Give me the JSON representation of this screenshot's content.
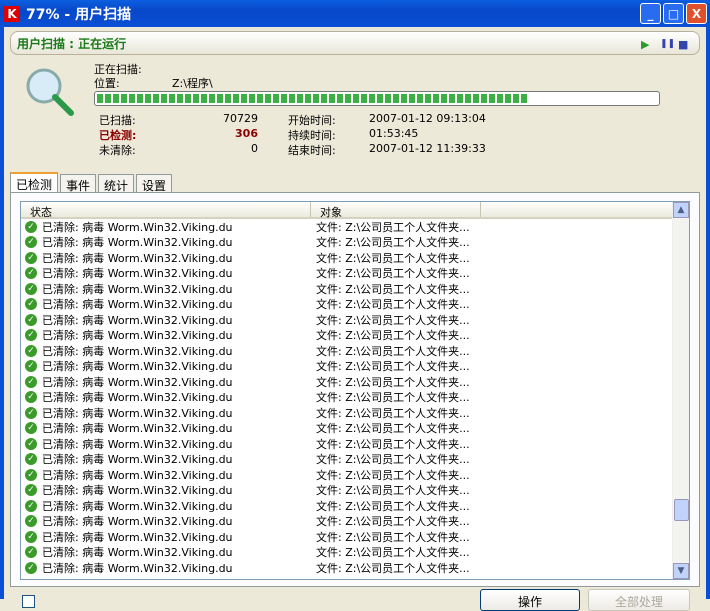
{
  "window": {
    "title": "77% - 用户扫描",
    "minimize": "_",
    "maximize": "□",
    "close": "X"
  },
  "status": {
    "text": "用户扫描 : 正在运行",
    "controls": {
      "play": "▶",
      "pause": "❚❚",
      "stop": "■"
    }
  },
  "scan": {
    "scanning_label": "正在扫描:",
    "location_label": "位置:",
    "location_value": "Z:\\程序\\",
    "progress": 77
  },
  "stats": {
    "scanned_label": "已扫描:",
    "scanned_value": "70729",
    "detected_label": "已检测:",
    "detected_value": "306",
    "uncleaned_label": "未清除:",
    "uncleaned_value": "0",
    "start_label": "开始时间:",
    "start_value": "2007-01-12 09:13:04",
    "duration_label": "持续时间:",
    "duration_value": "01:53:45",
    "end_label": "结束时间:",
    "end_value": "2007-01-12 11:39:33"
  },
  "tabs": [
    "已检测",
    "事件",
    "统计",
    "设置"
  ],
  "list": {
    "columns": [
      "状态",
      "对象"
    ],
    "row_status": "已清除: 病毒 Worm.Win32.Viking.du",
    "row_object": "文件: Z:\\公司员工个人文件夹...",
    "row_count": 23
  },
  "buttons": {
    "action": "操作",
    "process_all": "全部处理"
  }
}
